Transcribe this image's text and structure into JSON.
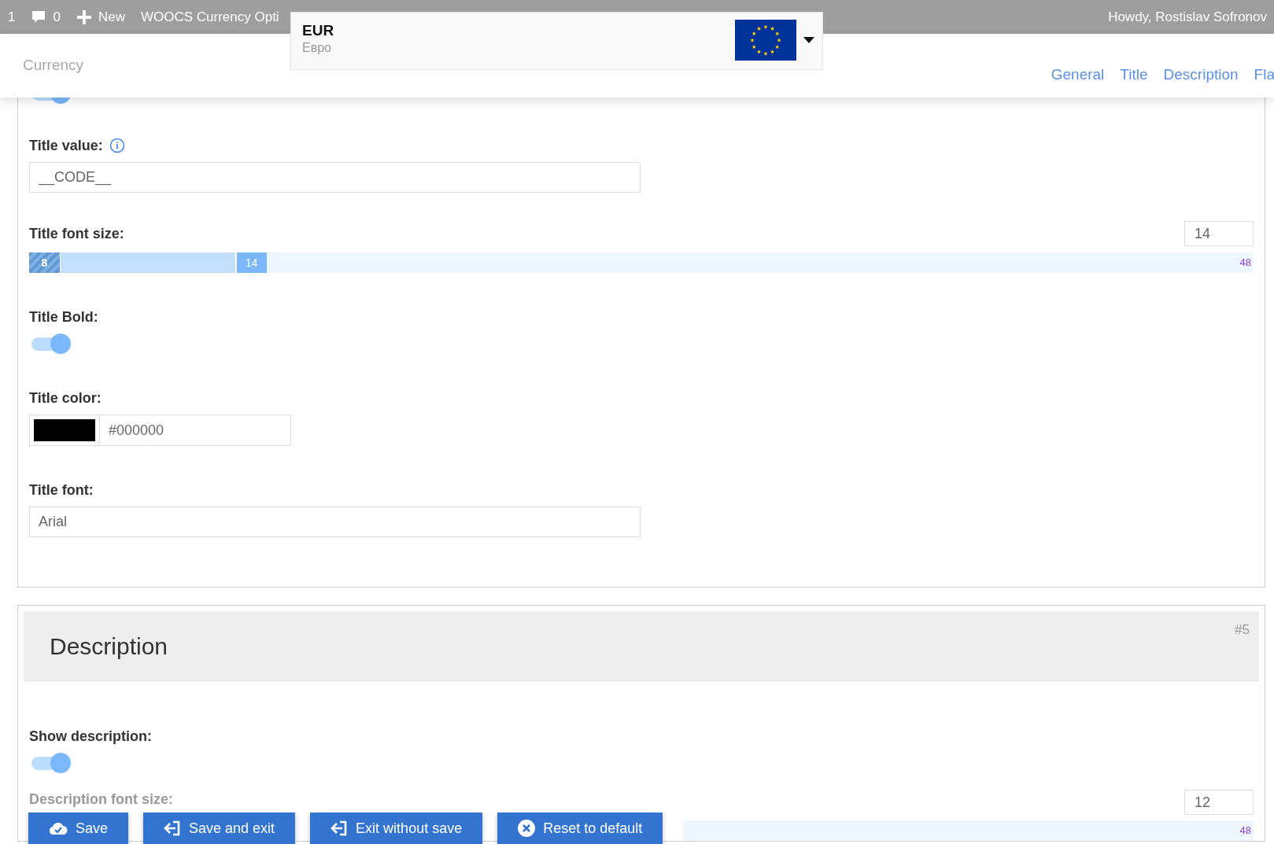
{
  "admin_bar": {
    "items": [
      {
        "kind": "count",
        "text": "1"
      },
      {
        "kind": "comments",
        "text": "0"
      },
      {
        "kind": "new",
        "text": "New"
      },
      {
        "kind": "link",
        "text": "WOOCS Currency Opti"
      }
    ],
    "greeting": "Howdy, Rostislav Sofronov"
  },
  "header": {
    "title": "Currency",
    "nav": [
      "General",
      "Title",
      "Description",
      "Fla"
    ]
  },
  "currency_select": {
    "code": "EUR",
    "name": "Евро"
  },
  "sections": [
    {
      "fields": [
        {
          "kind": "toggle",
          "on": true
        },
        {
          "kind": "text",
          "label": "Title value:",
          "info": true,
          "value": "__CODE__"
        },
        {
          "kind": "range",
          "label": "Title font size:",
          "value": "14",
          "min": "8",
          "handle": "14",
          "max": "48",
          "level": 0.194
        },
        {
          "kind": "toggle",
          "label": "Title Bold:",
          "on": true
        },
        {
          "kind": "color",
          "label": "Title color:",
          "value": "#000000"
        },
        {
          "kind": "text",
          "label": "Title font:",
          "value": "Arial"
        }
      ]
    },
    {
      "title": "Description",
      "number": "#5",
      "fields": [
        {
          "kind": "toggle",
          "label": "Show description:",
          "on": true
        },
        {
          "kind": "range",
          "label": "Description font size:",
          "value": "12",
          "max": "48"
        }
      ]
    }
  ],
  "actions": [
    {
      "kind": "save",
      "label": "Save"
    },
    {
      "kind": "exit",
      "label": "Save and exit"
    },
    {
      "kind": "exit",
      "label": "Exit without save"
    },
    {
      "kind": "reset",
      "label": "Reset to default"
    }
  ]
}
